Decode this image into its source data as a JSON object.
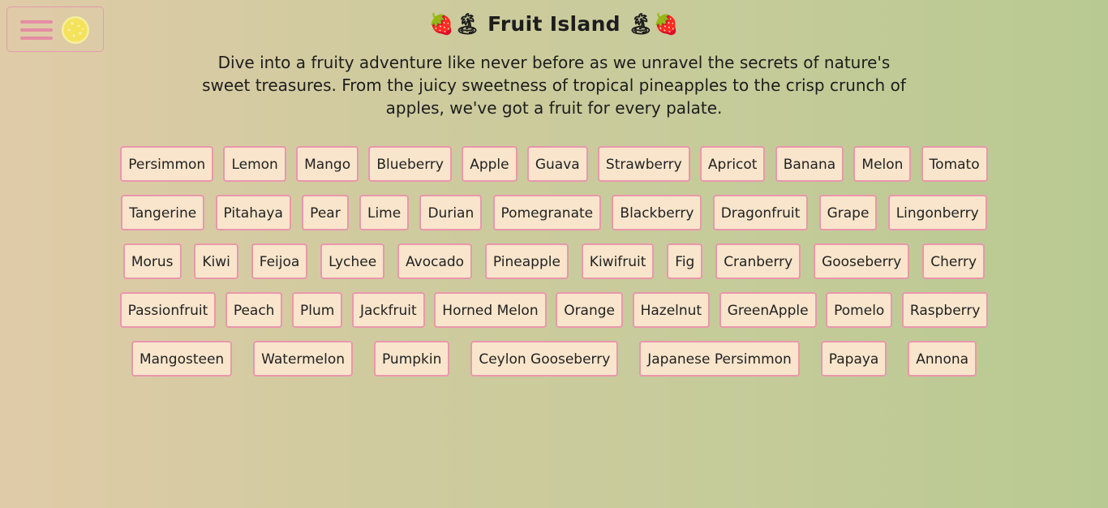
{
  "header": {
    "title_prefix": "🍓🏝",
    "title": "Fruit Island",
    "title_suffix": "🏝🍓",
    "description": "Dive into a fruity adventure like never before as we unravel the secrets of nature's sweet treasures. From the juicy sweetness of tropical pineapples to the crisp crunch of apples, we've got a fruit for every palate."
  },
  "toolbar": {
    "menu_icon": "hamburger-menu-icon",
    "theme_icon": "lemon-icon"
  },
  "colors": {
    "accent": "#e58da3",
    "chip_bg": "#f8e5cb",
    "chip_border": "#e997ac"
  },
  "fruits": [
    [
      "Persimmon",
      "Lemon",
      "Mango",
      "Blueberry",
      "Apple",
      "Guava",
      "Strawberry",
      "Apricot",
      "Banana",
      "Melon",
      "Tomato"
    ],
    [
      "Tangerine",
      "Pitahaya",
      "Pear",
      "Lime",
      "Durian",
      "Pomegranate",
      "Blackberry",
      "Dragonfruit",
      "Grape",
      "Lingonberry"
    ],
    [
      "Morus",
      "Kiwi",
      "Feijoa",
      "Lychee",
      "Avocado",
      "Pineapple",
      "Kiwifruit",
      "Fig",
      "Cranberry",
      "Gooseberry",
      "Cherry"
    ],
    [
      "Passionfruit",
      "Peach",
      "Plum",
      "Jackfruit",
      "Horned Melon",
      "Orange",
      "Hazelnut",
      "GreenApple",
      "Pomelo",
      "Raspberry"
    ],
    [
      "Mangosteen",
      "Watermelon",
      "Pumpkin",
      "Ceylon Gooseberry",
      "Japanese Persimmon",
      "Papaya",
      "Annona"
    ]
  ]
}
